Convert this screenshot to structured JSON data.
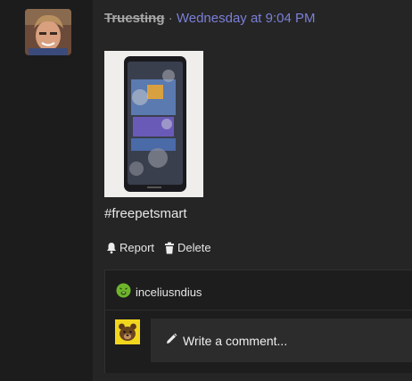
{
  "post": {
    "author": "Truesting",
    "separator": "·",
    "timestamp": "Wednesday at 9:04 PM",
    "text": "#freepetsmart"
  },
  "actions": {
    "report_label": "Report",
    "delete_label": "Delete"
  },
  "reactions": {
    "username": "inceliusndius",
    "reaction_icon": "sick-face-icon"
  },
  "comment": {
    "placeholder": "Write a comment..."
  },
  "colors": {
    "timestamp": "#7b7fd8",
    "background": "#1b1b1b",
    "reaction_green": "#6fb52c",
    "commenter_avatar": "#f2d61d"
  }
}
